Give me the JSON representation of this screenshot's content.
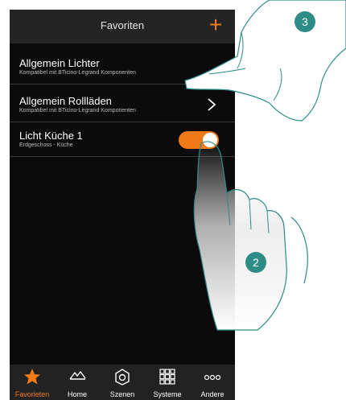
{
  "header": {
    "title": "Favoriten",
    "add_label": "+"
  },
  "favorites": [
    {
      "title": "Allgemein Lichter",
      "subtitle": "Kompatibel mit BTicino-Legrand Komponenten"
    },
    {
      "title": "Allgemein Rollläden",
      "subtitle": "Kompatibel mit BTicino-Legrand Komponenten",
      "control": "chevron-right-icon"
    },
    {
      "title": "Licht Küche 1",
      "subtitle": "Erdgeschoss - Küche",
      "control": "toggle",
      "toggle_on": true
    }
  ],
  "tabs": [
    {
      "label": "Favorieten",
      "icon": "star-icon",
      "active": true
    },
    {
      "label": "Home",
      "icon": "house-icon",
      "active": false
    },
    {
      "label": "Szenen",
      "icon": "scene-icon",
      "active": false
    },
    {
      "label": "Systeme",
      "icon": "grid-icon",
      "active": false
    },
    {
      "label": "Andere",
      "icon": "more-icon",
      "active": false
    }
  ],
  "annotations": {
    "step_a": "3",
    "step_b": "2"
  },
  "colors": {
    "accent": "#f07a16",
    "background": "#0b0b0b",
    "bar": "#242424",
    "badge": "#2e8c86"
  }
}
